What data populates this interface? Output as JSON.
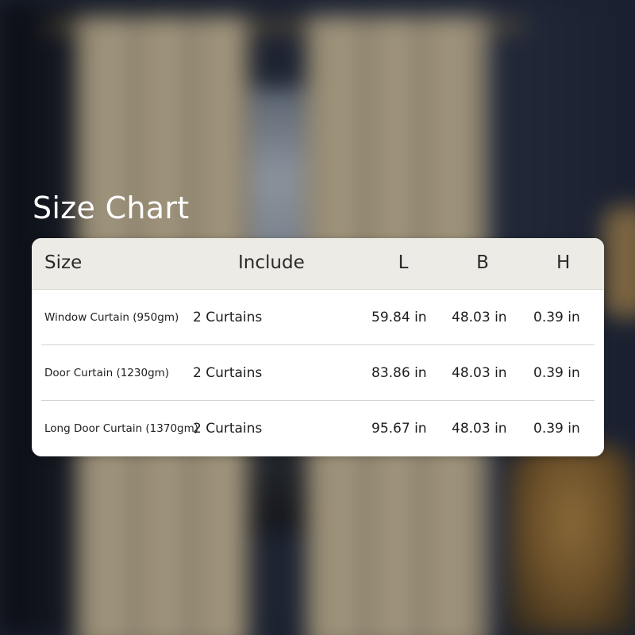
{
  "title": "Size Chart",
  "table": {
    "headers": {
      "size": "Size",
      "include": "Include",
      "l": "L",
      "b": "B",
      "h": "H"
    },
    "rows": [
      {
        "size": "Window Curtain (950gm)",
        "include": "2 Curtains",
        "l": "59.84 in",
        "b": "48.03 in",
        "h": "0.39 in"
      },
      {
        "size": "Door Curtain (1230gm)",
        "include": "2 Curtains",
        "l": "83.86 in",
        "b": "48.03 in",
        "h": "0.39 in"
      },
      {
        "size": "Long Door Curtain (1370gm)",
        "include": "2 Curtains",
        "l": "95.67 in",
        "b": "48.03 in",
        "h": "0.39 in"
      }
    ]
  }
}
